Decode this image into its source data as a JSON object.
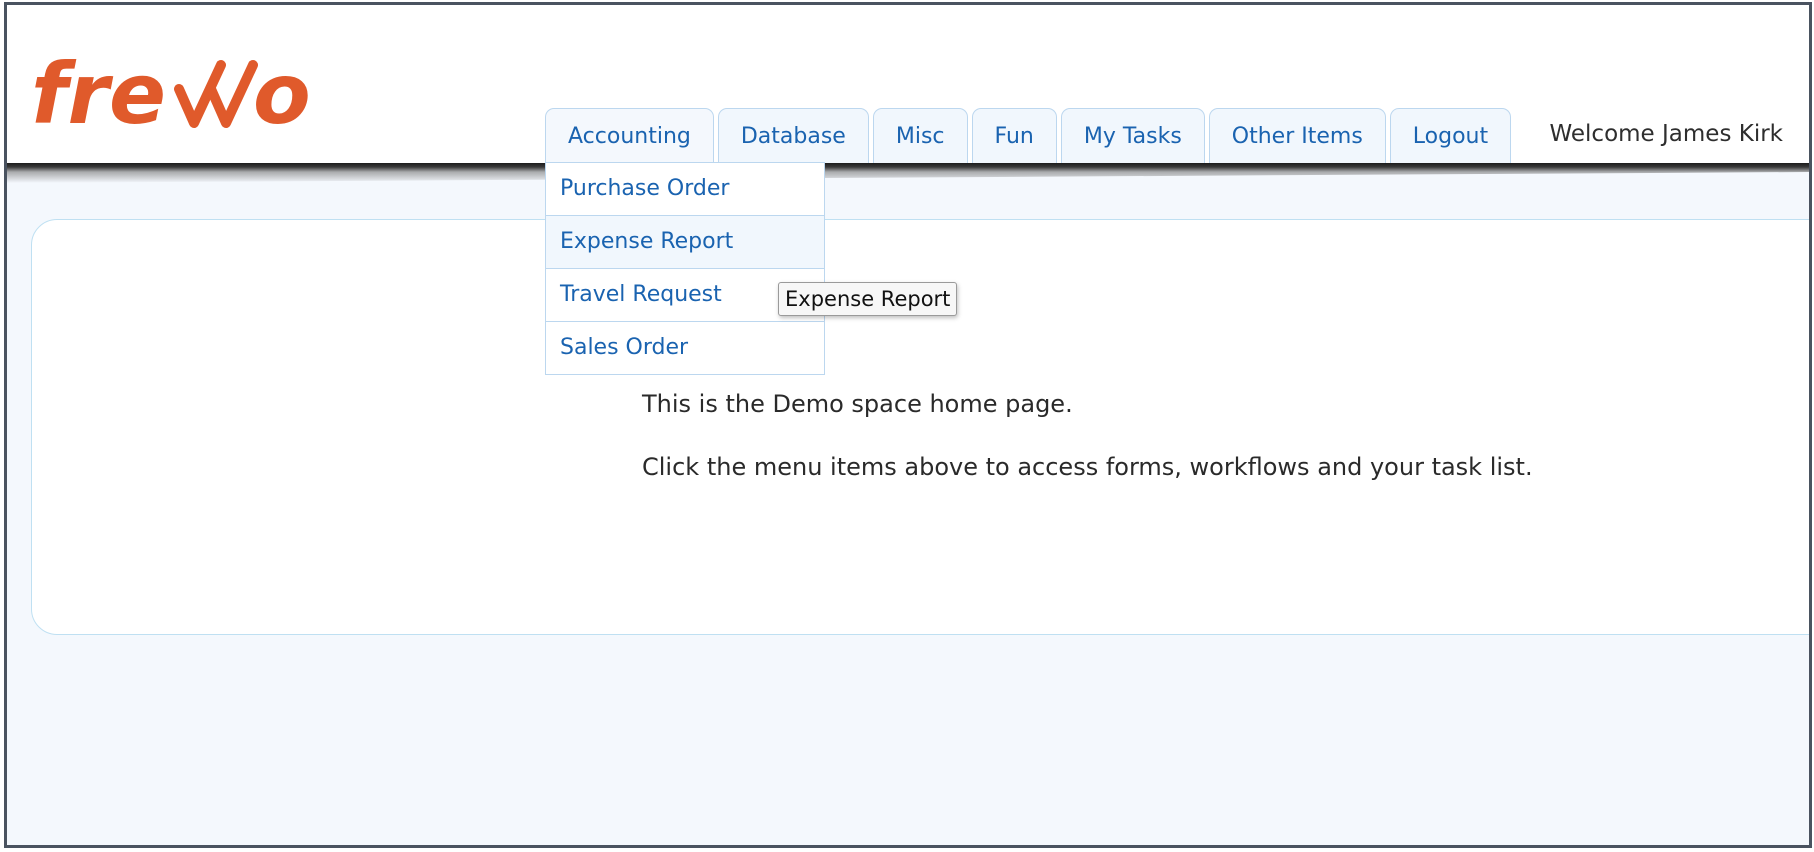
{
  "brand": {
    "logo_text": "frevvo",
    "accent_color": "#e05a2b"
  },
  "nav": {
    "tabs": [
      {
        "label": "Accounting"
      },
      {
        "label": "Database"
      },
      {
        "label": "Misc"
      },
      {
        "label": "Fun"
      },
      {
        "label": "My Tasks"
      },
      {
        "label": "Other Items"
      },
      {
        "label": "Logout"
      }
    ],
    "welcome": "Welcome James Kirk"
  },
  "dropdown": {
    "open_tab": "Accounting",
    "items": [
      {
        "label": "Purchase Order"
      },
      {
        "label": "Expense Report"
      },
      {
        "label": "Travel Request"
      },
      {
        "label": "Sales Order"
      }
    ],
    "hovered_item": "Expense Report"
  },
  "tooltip": {
    "text": "Expense Report"
  },
  "content": {
    "line1": "This is the Demo space home page.",
    "line2": "Click the menu items above to access forms, workflows and your task list."
  },
  "colors": {
    "link": "#1a63b0",
    "tab_border": "#bcd7ef",
    "page_background": "#f4f8fd"
  }
}
